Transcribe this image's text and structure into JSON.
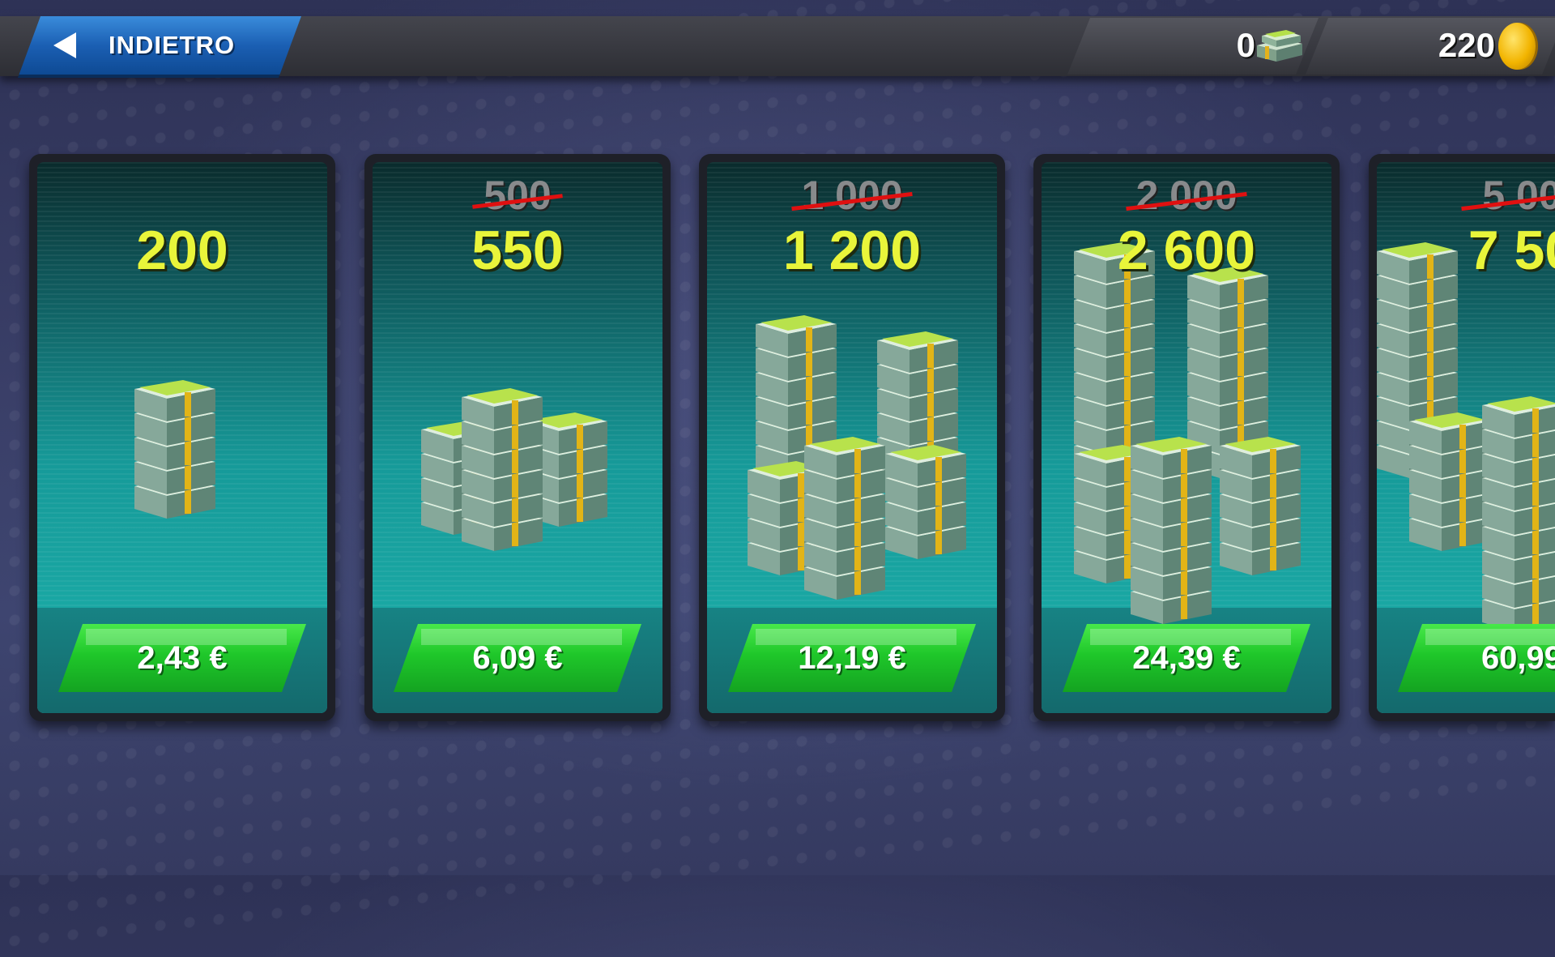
{
  "topbar": {
    "back_label": "INDIETRO",
    "cash_balance": "0",
    "coin_balance": "220"
  },
  "offers": [
    {
      "old_amount": "",
      "amount": "200",
      "price": "2,43 €",
      "bundle_size": 1
    },
    {
      "old_amount": "500",
      "amount": "550",
      "price": "6,09 €",
      "bundle_size": 2
    },
    {
      "old_amount": "1 000",
      "amount": "1 200",
      "price": "12,19 €",
      "bundle_size": 3
    },
    {
      "old_amount": "2 000",
      "amount": "2 600",
      "price": "24,39 €",
      "bundle_size": 4
    },
    {
      "old_amount": "5 00",
      "amount": "7 50",
      "price": "60,99",
      "bundle_size": 5
    }
  ],
  "colors": {
    "accent_amount": "#e9f53a",
    "buy_button": "#1fc72a",
    "back_button": "#1b5fb3",
    "strike": "#e01010"
  },
  "icons": [
    "back-arrow-icon",
    "cash-stack-icon",
    "gold-coin-icon",
    "cash-bundle-icon"
  ]
}
